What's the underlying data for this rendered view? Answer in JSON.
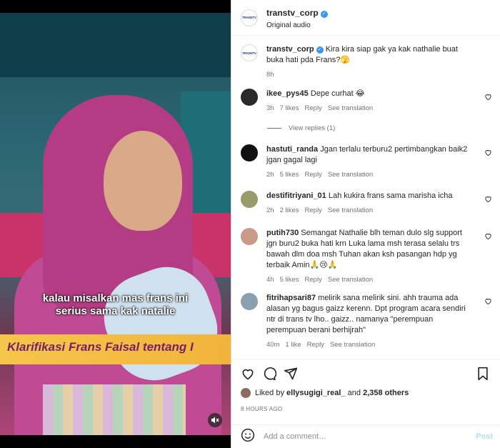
{
  "video": {
    "caption_line1": "kalau misalkan mas frans ini",
    "caption_line2": "serius sama kak natalie",
    "banner": "Klarifikasi Frans Faisal tentang I",
    "mute_icon": "speaker-mute-icon"
  },
  "header": {
    "username": "transtv_corp",
    "subtitle": "Original audio",
    "logo_text": "TRANSTV"
  },
  "caption": {
    "username": "transtv_corp",
    "text": "Kira kira siap gak ya kak nathalie buat buka hati pda Frans?🫣",
    "time": "8h"
  },
  "comments": [
    {
      "username": "ikee_pys45",
      "text": "Depe curhat 😂",
      "time": "3h",
      "likes": "7 likes",
      "reply": "Reply",
      "translate": "See translation",
      "avatar_color": "#2a2a2a"
    },
    {
      "username": "hastuti_randa",
      "text": "Jgan terlalu terburu2 pertimbangkan baik2 jgan gagal lagi",
      "time": "2h",
      "likes": "5 likes",
      "reply": "Reply",
      "translate": "See translation",
      "avatar_color": "#111111"
    },
    {
      "username": "destifitriyani_01",
      "text": "Lah kukira frans sama marisha icha",
      "time": "2h",
      "likes": "2 likes",
      "reply": "Reply",
      "translate": "See translation",
      "avatar_color": "#9a9a6a"
    },
    {
      "username": "putih730",
      "text": "Semangat Nathalie blh teman dulo slg support jgn buru2 buka hati krn Luka lama msh terasa selalu trs bawah dlm doa msh Tuhan akan ksh pasangan hdp yg terbaik Amin🙏😢🙏",
      "time": "4h",
      "likes": "5 likes",
      "reply": "Reply",
      "translate": "See translation",
      "avatar_color": "#c99a88"
    },
    {
      "username": "fitrihapsari87",
      "text": "melirik sana melirik sini. ahh trauma ada alasan yg bagus gaizz kerenn. Dpt program acara sendiri ntr di trans tv lho.. gaizz.. namanya \"perempuan perempuan berani berhijrah\"",
      "time": "40m",
      "likes": "1 like",
      "reply": "Reply",
      "translate": "See translation",
      "avatar_color": "#8aa0b0"
    }
  ],
  "view_replies": "View replies (1)",
  "likes_line": {
    "prefix": "Liked by",
    "user": "ellysugigi_real_",
    "mid": "and",
    "count": "2,358 others"
  },
  "time_ago": "8 HOURS AGO",
  "composer": {
    "placeholder": "Add a comment…",
    "post_label": "Post"
  }
}
